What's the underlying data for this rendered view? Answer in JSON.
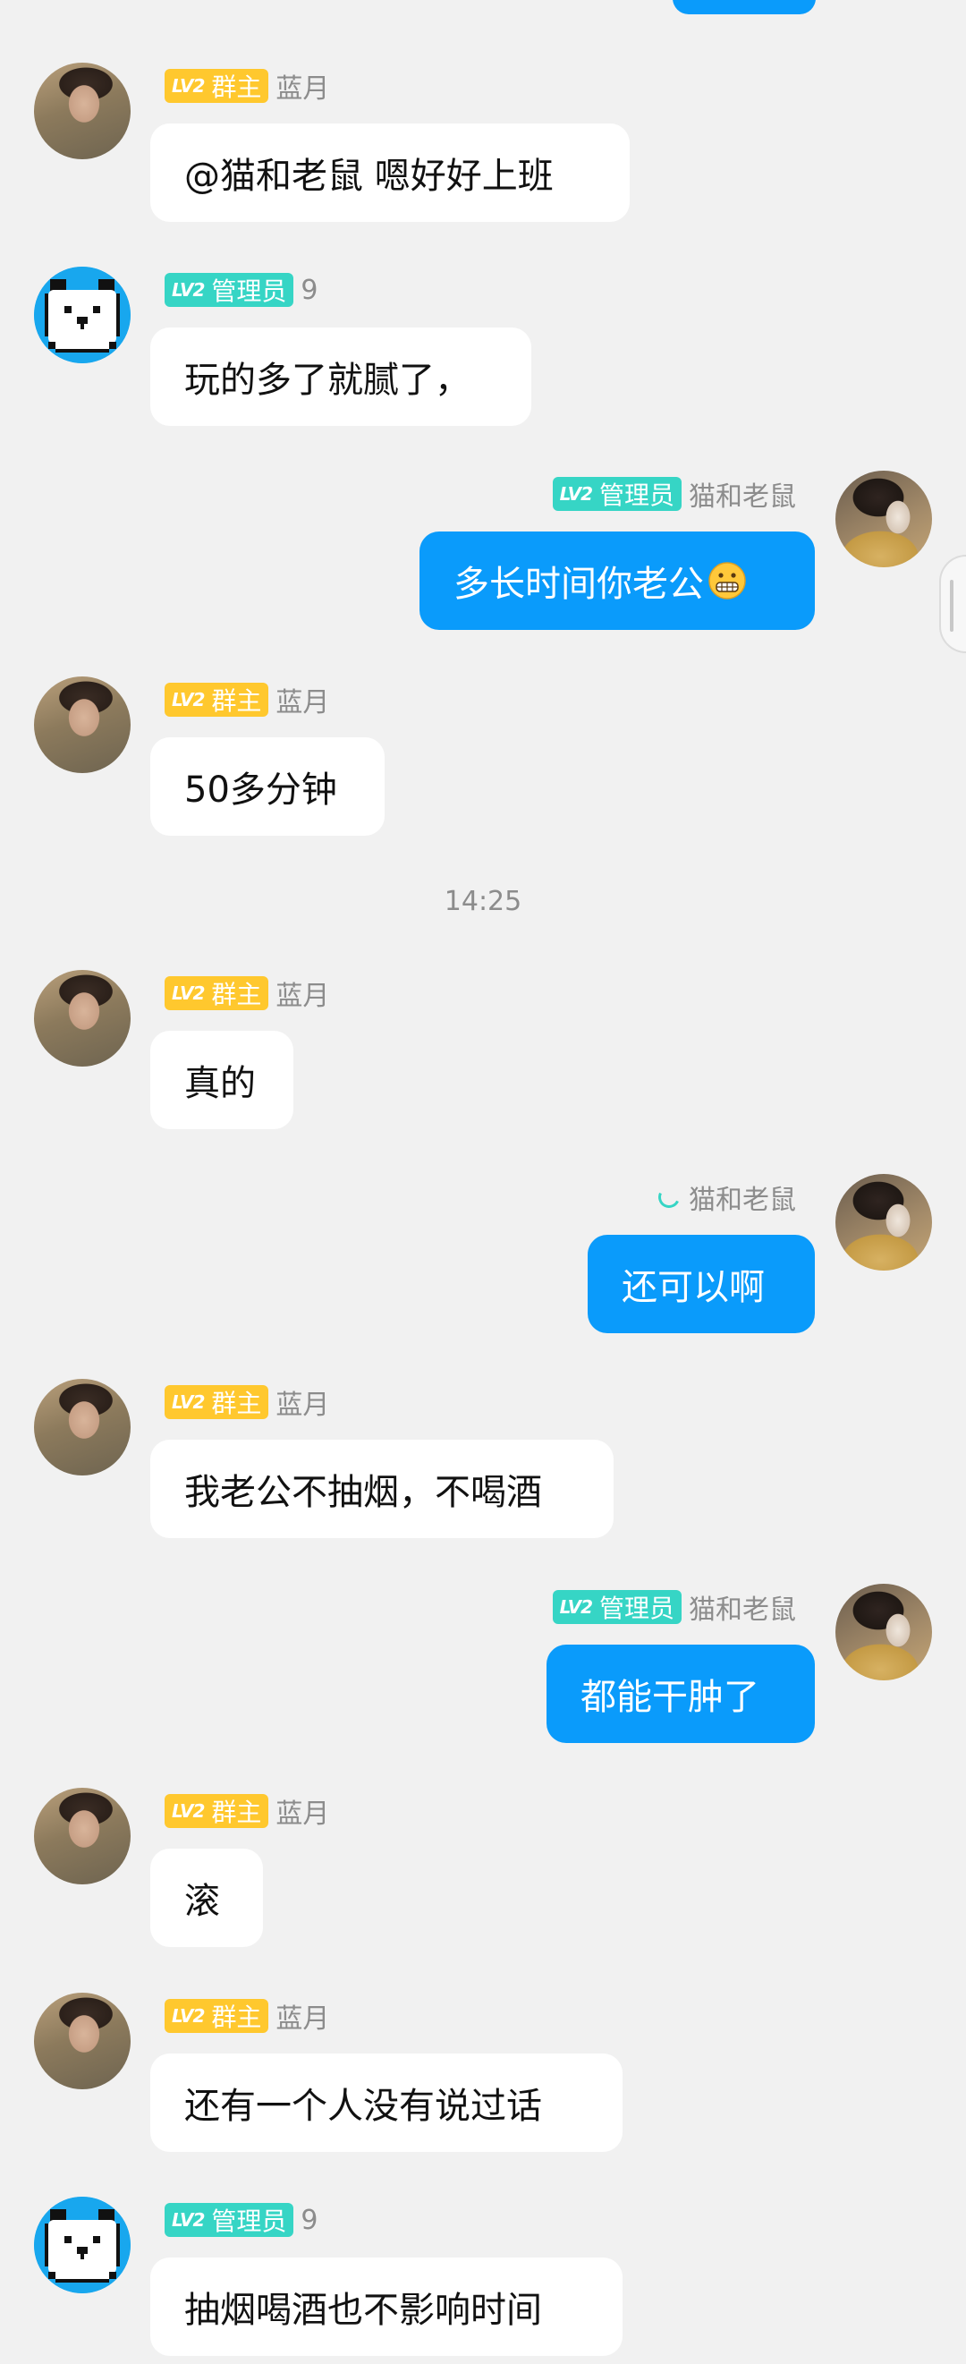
{
  "time_separator": "14:25",
  "messages": [
    {
      "side": "left",
      "avatar": "blue-moon-photo",
      "level": "LV2",
      "role": "群主",
      "sender": "蓝月",
      "text": "@猫和老鼠 嗯好好上班"
    },
    {
      "side": "left",
      "avatar": "panda-bear",
      "level": "LV2",
      "role": "管理员",
      "sender": "9",
      "text": "玩的多了就腻了，"
    },
    {
      "side": "right",
      "avatar": "cat-and-mouse-photo",
      "level": "LV2",
      "role": "管理员",
      "sender": "猫和老鼠",
      "text": "多长时间你老公"
    },
    {
      "side": "left",
      "avatar": "blue-moon-photo",
      "level": "LV2",
      "role": "群主",
      "sender": "蓝月",
      "text": "50多分钟"
    },
    {
      "side": "left",
      "avatar": "blue-moon-photo",
      "level": "LV2",
      "role": "群主",
      "sender": "蓝月",
      "text": "真的"
    },
    {
      "side": "right",
      "avatar": "cat-and-mouse-photo",
      "level": "",
      "role": "",
      "sender": "猫和老鼠",
      "text": "还可以啊"
    },
    {
      "side": "left",
      "avatar": "blue-moon-photo",
      "level": "LV2",
      "role": "群主",
      "sender": "蓝月",
      "text": "我老公不抽烟，不喝酒"
    },
    {
      "side": "right",
      "avatar": "cat-and-mouse-photo",
      "level": "LV2",
      "role": "管理员",
      "sender": "猫和老鼠",
      "text": "都能干肿了"
    },
    {
      "side": "left",
      "avatar": "blue-moon-photo",
      "level": "LV2",
      "role": "群主",
      "sender": "蓝月",
      "text": "滚"
    },
    {
      "side": "left",
      "avatar": "blue-moon-photo",
      "level": "LV2",
      "role": "群主",
      "sender": "蓝月",
      "text": "还有一个人没有说过话"
    },
    {
      "side": "left",
      "avatar": "panda-bear",
      "level": "LV2",
      "role": "管理员",
      "sender": "9",
      "text": "抽烟喝酒也不影响时间"
    }
  ],
  "colors": {
    "background": "#f1f1f1",
    "outgoing_bubble": "#0a9bfb",
    "incoming_bubble": "#ffffff",
    "owner_badge": "#ffc82e",
    "admin_badge": "#36d5c5",
    "meta_text": "#8c8c8c"
  }
}
